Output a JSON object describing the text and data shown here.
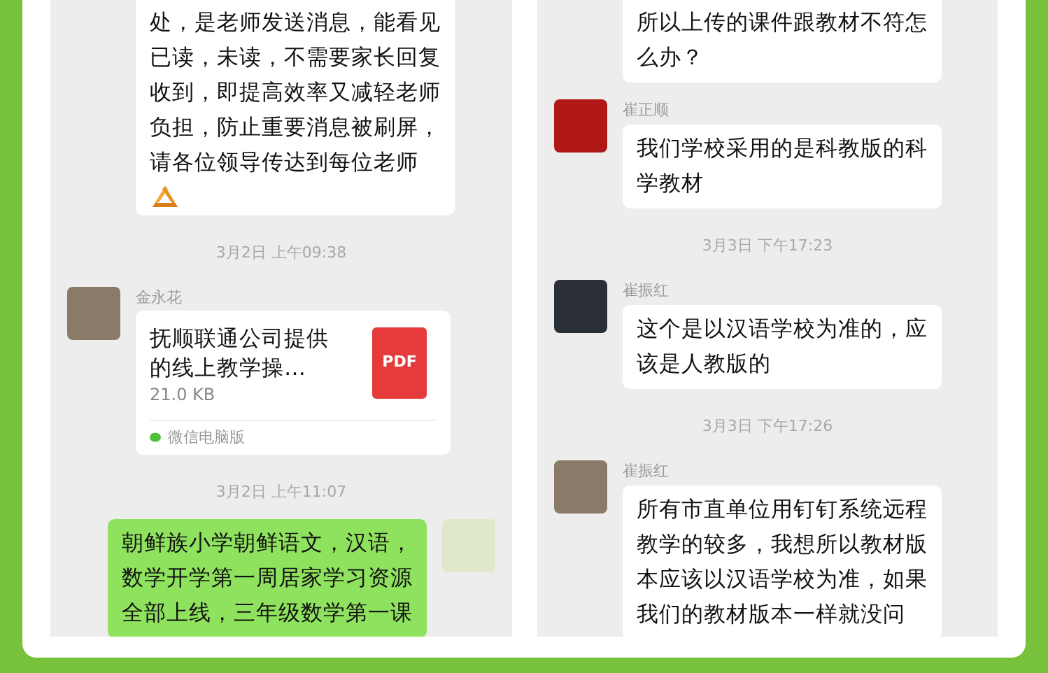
{
  "panels": [
    {
      "items": [
        {
          "kind": "continued",
          "text": "处，是老师发送消息，能看见已读，未读，不需要家长回复收到，即提高效率又减轻老师负担，防止重要消息被刷屏，请各位领导传达到每位老师",
          "emoji": true
        },
        {
          "kind": "time",
          "text": "3月2日 上午09:38"
        },
        {
          "kind": "file",
          "sender": "金永花",
          "title": "抚顺联通公司提供的线上教学操…",
          "size": "21.0 KB",
          "badge": "PDF",
          "source": "微信电脑版"
        },
        {
          "kind": "time",
          "text": "3月2日 上午11:07"
        },
        {
          "kind": "own",
          "text": "朝鲜族小学朝鲜语文，汉语，数学开学第一周居家学习资源全部上线，三年级数学第一课"
        }
      ]
    },
    {
      "items": [
        {
          "kind": "continued",
          "text": "所以上传的课件跟教材不符怎么办？",
          "emoji": false
        },
        {
          "kind": "message",
          "sender": "崔正顺",
          "text": "我们学校采用的是科教版的科学教材"
        },
        {
          "kind": "time",
          "text": "3月3日 下午17:23"
        },
        {
          "kind": "message",
          "sender": "崔振红",
          "text": "这个是以汉语学校为准的，应该是人教版的"
        },
        {
          "kind": "time",
          "text": "3月3日 下午17:26"
        },
        {
          "kind": "message",
          "sender": "崔振红",
          "text": "所有市直单位用钉钉系统远程教学的较多，我想所以教材版本应该以汉语学校为准，如果我们的教材版本一样就没问"
        }
      ]
    }
  ]
}
